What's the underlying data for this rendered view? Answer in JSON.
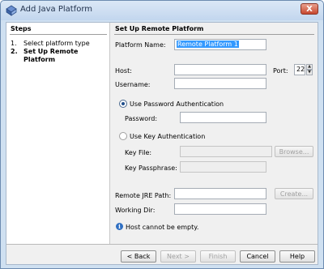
{
  "window": {
    "title": "Add Java Platform",
    "close_label": "X"
  },
  "steps": {
    "title": "Steps",
    "items": [
      {
        "num": "1.",
        "label": "Select platform type"
      },
      {
        "num": "2.",
        "label": "Set Up Remote Platform"
      }
    ]
  },
  "panel": {
    "title": "Set Up Remote Platform",
    "platform_name_label": "Platform Name:",
    "platform_name_value": "Remote Platform 1",
    "host_label": "Host:",
    "host_value": "",
    "port_label": "Port:",
    "port_value": "22",
    "username_label": "Username:",
    "username_value": "",
    "use_password_auth": "Use Password Authentication",
    "password_label": "Password:",
    "password_value": "",
    "use_key_auth": "Use Key Authentication",
    "key_file_label": "Key File:",
    "key_file_value": "",
    "browse_label": "Browse...",
    "key_passphrase_label": "Key Passphrase:",
    "key_passphrase_value": "",
    "remote_jre_label": "Remote JRE Path:",
    "remote_jre_value": "",
    "create_label": "Create...",
    "working_dir_label": "Working Dir:",
    "working_dir_value": "",
    "message": "Host cannot be empty."
  },
  "buttons": {
    "back": "< Back",
    "next": "Next >",
    "finish": "Finish",
    "cancel": "Cancel",
    "help": "Help"
  },
  "icons": {
    "app": "java-platform-icon",
    "info": "info-icon"
  }
}
